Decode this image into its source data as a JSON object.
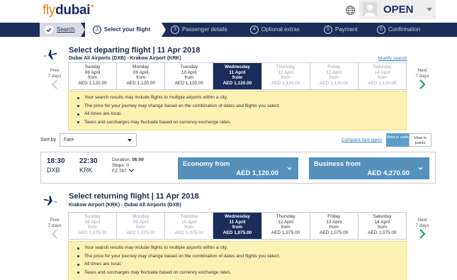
{
  "header": {
    "logo_fly": "fly",
    "logo_dubai": "dubai",
    "account_label": "OPEN"
  },
  "stepper": [
    {
      "num": "",
      "label": "Search",
      "state": "done"
    },
    {
      "num": "2",
      "label": "Select your flight",
      "state": "active"
    },
    {
      "num": "3",
      "label": "Passenger details",
      "state": "pending"
    },
    {
      "num": "4",
      "label": "Optional extras",
      "state": "pending"
    },
    {
      "num": "5",
      "label": "Payment",
      "state": "pending"
    },
    {
      "num": "6",
      "label": "Confirmation",
      "state": "pending"
    }
  ],
  "departing": {
    "title": "Select departing flight | 11 Apr 2018",
    "route": "Dubai All Airports (DXB) - Krakow Airport (KRK)",
    "modify_label": "Modify search",
    "prev": {
      "l1": "Prev",
      "l2": "7 days"
    },
    "next": {
      "l1": "Next",
      "l2": "7 days"
    },
    "dates": [
      {
        "day": "Sunday",
        "date": "08 April",
        "from": "from",
        "price": "AED 1,120.00",
        "state": "normal"
      },
      {
        "day": "Monday",
        "date": "09 April",
        "from": "from",
        "price": "AED 1,120.00",
        "state": "normal"
      },
      {
        "day": "Tuesday",
        "date": "10 April",
        "from": "from",
        "price": "AED 1,120.00",
        "state": "normal"
      },
      {
        "day": "Wednesday",
        "date": "11 April",
        "from": "from",
        "price": "AED 1,120.00",
        "state": "selected"
      },
      {
        "day": "Thursday",
        "date": "12 April",
        "from": "from",
        "price": "AED 1,120.00",
        "state": "past"
      },
      {
        "day": "Friday",
        "date": "13 April",
        "from": "from",
        "price": "AED 1,120.00",
        "state": "past"
      },
      {
        "day": "Saturday",
        "date": "14 April",
        "from": "from",
        "price": "AED 1,120.00",
        "state": "past"
      }
    ],
    "notices": [
      "Your search results may include flights to multiple airports within a city.",
      "The price for your journey may change based on the combination of dates and flights you select.",
      "All times are local.",
      "Taxes and surcharges may fluctuate based on currency exchange rates."
    ]
  },
  "sort": {
    "label": "Sort by",
    "value": "Fare",
    "compare_label": "Compare fare types",
    "view_cash": "View in cash",
    "view_points": "View in points"
  },
  "flight": {
    "dep_time": "18:30",
    "dep_city": "DXB",
    "arr_time": "22:30",
    "arr_city": "KRK",
    "duration_label": "Duration:",
    "duration": "06:00",
    "stops": "Stops: 0",
    "flight_no": "FZ 787",
    "economy_label": "Economy from",
    "economy_price": "AED 1,120.00",
    "business_label": "Business from",
    "business_price": "AED 4,270.00"
  },
  "returning": {
    "title": "Select returning flight | 11 Apr 2018",
    "route": "Krakow Airport (KRK) - Dubai All Airports (DXB)",
    "prev": {
      "l1": "Prev",
      "l2": "7 days"
    },
    "next": {
      "l1": "Next",
      "l2": "7 days"
    },
    "dates": [
      {
        "day": "Sunday",
        "date": "08 April",
        "from": "from",
        "price": "AED 1,075.00",
        "state": "past"
      },
      {
        "day": "Monday",
        "date": "09 April",
        "from": "from",
        "price": "AED 1,075.00",
        "state": "past"
      },
      {
        "day": "Tuesday",
        "date": "10 April",
        "from": "from",
        "price": "AED 1,075.00",
        "state": "past"
      },
      {
        "day": "Wednesday",
        "date": "11 April",
        "from": "from",
        "price": "AED 1,075.00",
        "state": "selected"
      },
      {
        "day": "Thursday",
        "date": "12 April",
        "from": "from",
        "price": "AED 1,075.00",
        "state": "normal"
      },
      {
        "day": "Friday",
        "date": "13 April",
        "from": "from",
        "price": "AED 1,075.00",
        "state": "normal"
      },
      {
        "day": "Saturday",
        "date": "14 April",
        "from": "from",
        "price": "AED 1,075.00",
        "state": "normal"
      }
    ],
    "notices": [
      "Your search results may include flights to multiple airports within a city.",
      "The price for your journey may change based on the combination of dates and flights you select.",
      "All times are local.",
      "Taxes and surcharges may fluctuate based on currency exchange rates."
    ]
  },
  "colors": {
    "navy": "#1c2c5b",
    "orange": "#f0820f",
    "teal_arrow": "#1aa08a",
    "fare_blue": "#5591bb",
    "notice_bg": "#fbf2b3"
  }
}
